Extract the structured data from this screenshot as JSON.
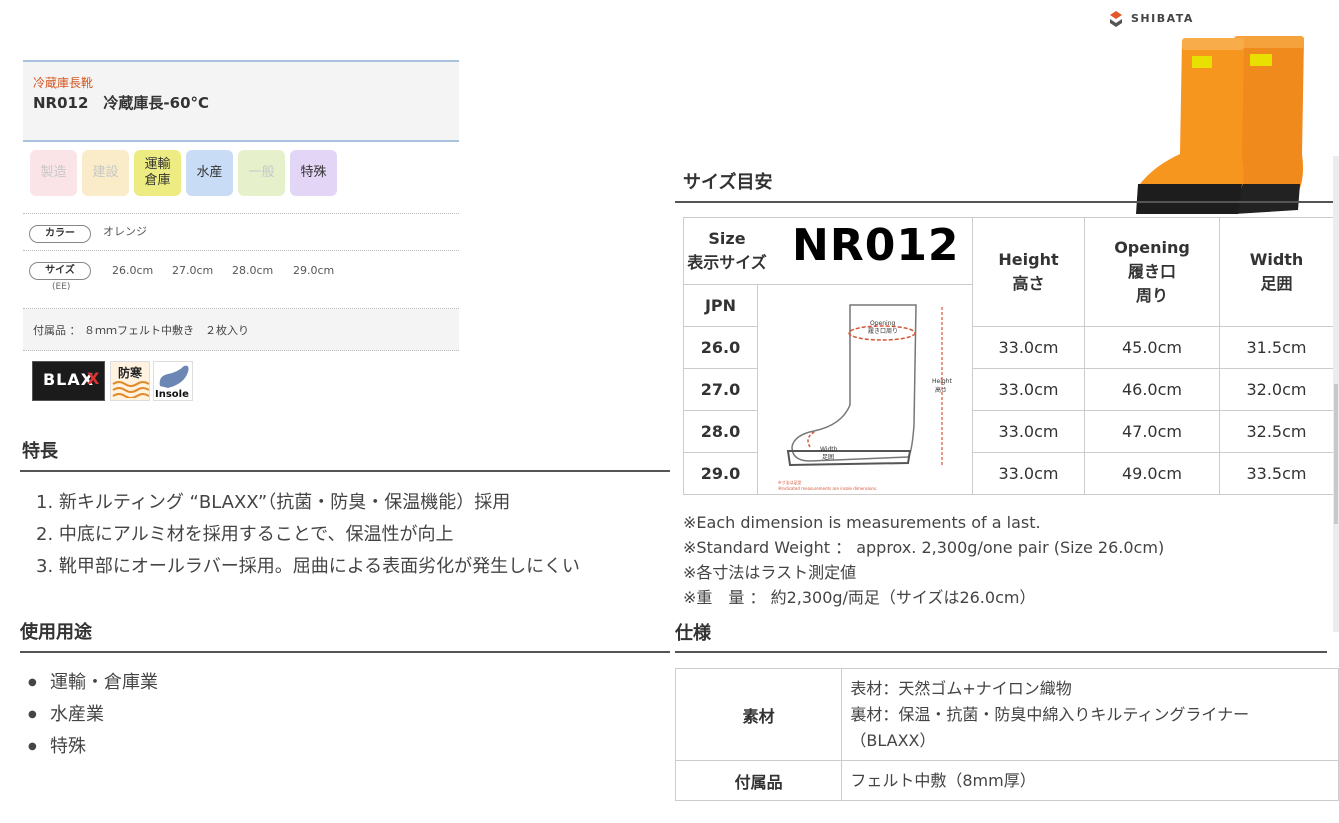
{
  "product": {
    "category": "冷蔵庫長靴",
    "title": "NR012　冷蔵庫長-60°C"
  },
  "tags": [
    {
      "label": "製造",
      "active": false,
      "bg": "#fbe4e8"
    },
    {
      "label": "建設",
      "active": false,
      "bg": "#fbecc9"
    },
    {
      "label": "運輸\n倉庫",
      "active": true,
      "bg": "#ecec83"
    },
    {
      "label": "水産",
      "active": true,
      "bg": "#c9dcf5"
    },
    {
      "label": "一般",
      "active": false,
      "bg": "#e6f1cc"
    },
    {
      "label": "特殊",
      "active": true,
      "bg": "#e3d5f5"
    }
  ],
  "specs": {
    "color_label": "カラー",
    "color_value": "オレンジ",
    "size_label": "サイズ",
    "size_sub": "(EE)",
    "sizes": [
      "26.0cm",
      "27.0cm",
      "28.0cm",
      "29.0cm"
    ],
    "accessory": "付属品 ： ８ｍｍフェルト中敷き　２枚入り"
  },
  "badges": {
    "blax": "BLAX",
    "bouka": "防寒",
    "insole": "Insole"
  },
  "brand": "SHIBATA",
  "features": {
    "title": "特長",
    "items": [
      "1. 新キルティング “BLAXX”（抗菌・防臭・保温機能）採用",
      "2. 中底にアルミ材を採用することで、保温性が向上",
      "3. 靴甲部にオールラバー採用。屈曲による表面劣化が発生しにくい"
    ]
  },
  "usage": {
    "title": "使用用途",
    "items": [
      "運輸・倉庫業",
      "水産業",
      "特殊"
    ]
  },
  "size_guide": {
    "title": "サイズ目安",
    "size_header_en": "Size",
    "size_header_jp": "表示サイズ",
    "model": "NR012",
    "jpn": "JPN",
    "col_height": [
      "Height",
      "高さ"
    ],
    "col_opening": [
      "Opening",
      "履き口",
      "周り"
    ],
    "col_width": [
      "Width",
      "足囲"
    ],
    "diagram": {
      "opening": "Opening",
      "opening_jp": "履き口周り",
      "height": "Height",
      "height_jp": "高さ",
      "width": "Width",
      "width_jp": "足囲",
      "note1": "※寸法は足型",
      "note2": "※Indicated measurements are insole dimensions."
    },
    "rows": [
      {
        "size": "26.0",
        "height": "33.0cm",
        "opening": "45.0cm",
        "width": "31.5cm"
      },
      {
        "size": "27.0",
        "height": "33.0cm",
        "opening": "46.0cm",
        "width": "32.0cm"
      },
      {
        "size": "28.0",
        "height": "33.0cm",
        "opening": "47.0cm",
        "width": "32.5cm"
      },
      {
        "size": "29.0",
        "height": "33.0cm",
        "opening": "49.0cm",
        "width": "33.5cm"
      }
    ],
    "notes": [
      "※Each dimension is measurements of a last.",
      "※Standard Weight ： approx. 2,300g/one pair (Size 26.0cm)",
      "※各寸法はラスト測定値",
      "※重　量 ： 約2,300g/両足（サイズは26.0cm）"
    ]
  },
  "spec_table": {
    "title": "仕様",
    "rows": [
      {
        "key": "素材",
        "lines": [
          "表材：天然ゴム+ナイロン織物",
          "裏材：保温・抗菌・防臭中綿入りキルティングライナー",
          "（BLAXX）"
        ]
      },
      {
        "key": "付属品",
        "lines": [
          "フェルト中敷（8mm厚）"
        ]
      }
    ]
  }
}
